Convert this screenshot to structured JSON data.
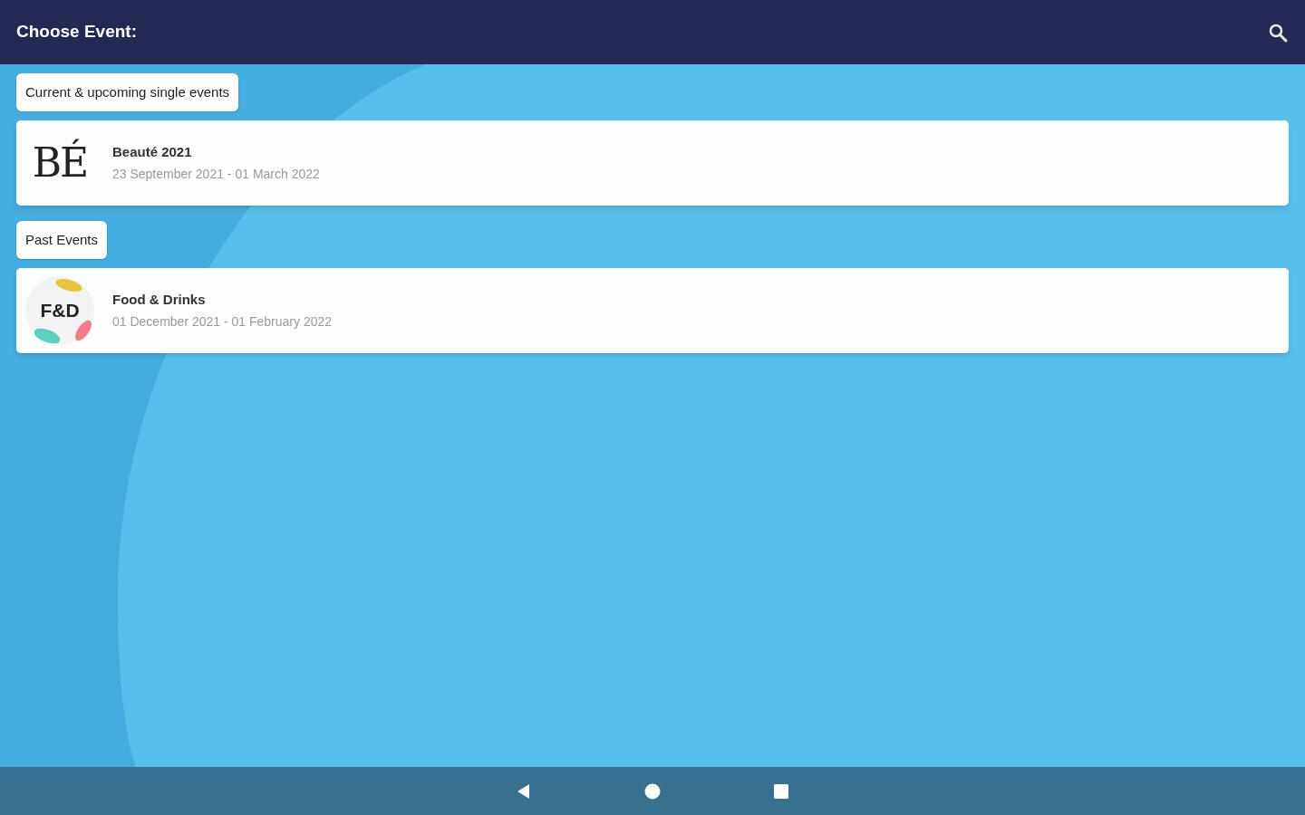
{
  "app_bar": {
    "title": "Choose Event:"
  },
  "sections": [
    {
      "label": "Current & upcoming single events",
      "events": [
        {
          "kind": "serif",
          "logo_text": "BÉ",
          "name": "Beauté 2021",
          "dates": "23 September 2021 - 01 March 2022"
        }
      ]
    },
    {
      "label": "Past Events",
      "events": [
        {
          "kind": "petals",
          "logo_text": "F&D",
          "name": "Food & Drinks",
          "dates": "01 December 2021 - 01 February 2022"
        }
      ]
    }
  ]
}
